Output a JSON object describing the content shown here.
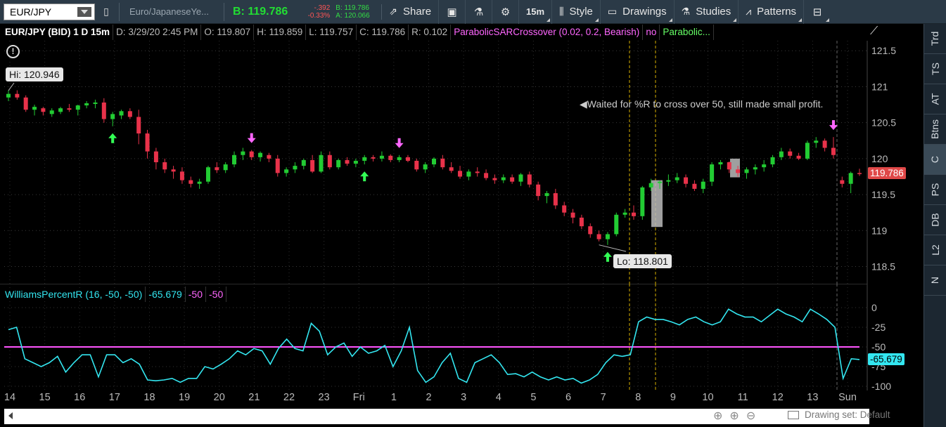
{
  "toolbar": {
    "symbol": "EUR/JPY",
    "description": "Euro/JapaneseYe...",
    "last": "B: 119.786",
    "change_net": "-.392",
    "change_pct": "-0.33%",
    "bid": "B: 119.786",
    "ask": "A: 120.066",
    "share_label": "Share",
    "timeframe_label": "15m",
    "style_label": "Style",
    "drawings_label": "Drawings",
    "studies_label": "Studies",
    "patterns_label": "Patterns"
  },
  "header": {
    "title": "EUR/JPY (BID) 1 D 15m",
    "date": "D: 3/29/20 2:45 PM",
    "open": "O: 119.807",
    "high": "H: 119.859",
    "low": "L: 119.757",
    "close": "C: 119.786",
    "range": "R: 0.102",
    "strategy": "ParabolicSARCrossover (0.02, 0.2, Bearish)",
    "strategy_flag": "no",
    "strategy2": "Parabolic..."
  },
  "price_panel": {
    "hi_label": "Hi: 120.946",
    "lo_label": "Lo: 118.801",
    "note": "Waited for %R to cross over 50, still made small profit.",
    "current_price": "119.786",
    "y_ticks": [
      "121.5",
      "121",
      "120.5",
      "120",
      "119.5",
      "119",
      "118.5"
    ]
  },
  "indicator": {
    "name": "WilliamsPercentR (16, -50, -50)",
    "value": "-65.679",
    "level1": "-50",
    "level2": "-50",
    "y_ticks": [
      "0",
      "-25",
      "-50",
      "-75",
      "-100"
    ],
    "current_value": "-65.679"
  },
  "x_labels": [
    "14",
    "15",
    "16",
    "17",
    "18",
    "19",
    "20",
    "21",
    "22",
    "23",
    "Fri",
    "1",
    "2",
    "3",
    "4",
    "5",
    "6",
    "7",
    "8",
    "9",
    "10",
    "11",
    "12",
    "13",
    "Sun"
  ],
  "sidebar_tabs": [
    "Trd",
    "TS",
    "AT",
    "Btns",
    "C",
    "PS",
    "DB",
    "L2",
    "N"
  ],
  "bottom": {
    "drawing_set": "Drawing set: Default"
  },
  "colors": {
    "up": "#22cc33",
    "down": "#e8324a",
    "pink": "#ff66ff",
    "cyan": "#33e6f0",
    "toolbar": "#2b3a47"
  },
  "chart_data": {
    "type": "candlestick",
    "x_labels": [
      "14",
      "15",
      "16",
      "17",
      "18",
      "19",
      "20",
      "21",
      "22",
      "23",
      "Fri",
      "1",
      "2",
      "3",
      "4",
      "5",
      "6",
      "7",
      "8",
      "9",
      "10",
      "11",
      "12",
      "13",
      "Sun"
    ],
    "price_ylim": [
      118.3,
      121.6
    ],
    "ohlc": [
      [
        120.85,
        120.95,
        120.8,
        120.9
      ],
      [
        120.9,
        120.95,
        120.82,
        120.85
      ],
      [
        120.85,
        120.88,
        120.65,
        120.68
      ],
      [
        120.68,
        120.75,
        120.6,
        120.72
      ],
      [
        120.7,
        120.72,
        120.6,
        120.65
      ],
      [
        120.62,
        120.7,
        120.58,
        120.67
      ],
      [
        120.65,
        120.72,
        120.62,
        120.7
      ],
      [
        120.7,
        120.76,
        120.65,
        120.68
      ],
      [
        120.68,
        120.75,
        120.6,
        120.74
      ],
      [
        120.74,
        120.8,
        120.7,
        120.77
      ],
      [
        120.76,
        120.82,
        120.7,
        120.78
      ],
      [
        120.78,
        120.84,
        120.5,
        120.55
      ],
      [
        120.55,
        120.65,
        120.45,
        120.62
      ],
      [
        120.6,
        120.68,
        120.55,
        120.66
      ],
      [
        120.66,
        120.7,
        120.55,
        120.58
      ],
      [
        120.58,
        120.68,
        120.2,
        120.35
      ],
      [
        120.35,
        120.4,
        120.0,
        120.1
      ],
      [
        120.1,
        120.15,
        119.85,
        119.95
      ],
      [
        119.95,
        120.0,
        119.8,
        119.85
      ],
      [
        119.85,
        119.9,
        119.72,
        119.82
      ],
      [
        119.82,
        119.88,
        119.65,
        119.7
      ],
      [
        119.7,
        119.75,
        119.6,
        119.65
      ],
      [
        119.65,
        119.72,
        119.58,
        119.68
      ],
      [
        119.68,
        119.9,
        119.65,
        119.88
      ],
      [
        119.88,
        119.95,
        119.8,
        119.84
      ],
      [
        119.84,
        119.95,
        119.8,
        119.92
      ],
      [
        119.92,
        120.1,
        119.88,
        120.05
      ],
      [
        120.05,
        120.15,
        119.98,
        120.1
      ],
      [
        120.1,
        120.12,
        119.98,
        120.02
      ],
      [
        120.02,
        120.1,
        119.96,
        120.08
      ],
      [
        120.05,
        120.08,
        119.95,
        120.0
      ],
      [
        120.0,
        120.05,
        119.75,
        119.8
      ],
      [
        119.8,
        119.88,
        119.75,
        119.85
      ],
      [
        119.85,
        119.95,
        119.8,
        119.9
      ],
      [
        119.9,
        120.0,
        119.85,
        119.98
      ],
      [
        119.98,
        120.05,
        119.8,
        119.82
      ],
      [
        119.82,
        120.1,
        119.8,
        120.05
      ],
      [
        120.05,
        120.1,
        119.85,
        119.88
      ],
      [
        119.88,
        120.0,
        119.85,
        119.98
      ],
      [
        119.98,
        120.02,
        119.9,
        119.93
      ],
      [
        119.93,
        120.0,
        119.88,
        119.97
      ],
      [
        119.97,
        120.05,
        119.92,
        120.02
      ],
      [
        120.02,
        120.05,
        119.96,
        120.0
      ],
      [
        120.0,
        120.1,
        119.96,
        120.04
      ],
      [
        120.04,
        120.06,
        119.95,
        119.98
      ],
      [
        119.98,
        120.05,
        119.95,
        120.02
      ],
      [
        120.02,
        120.05,
        119.95,
        119.97
      ],
      [
        119.97,
        120.0,
        119.82,
        119.85
      ],
      [
        119.85,
        119.95,
        119.8,
        119.92
      ],
      [
        119.92,
        120.02,
        119.88,
        120.0
      ],
      [
        120.0,
        120.05,
        119.85,
        119.88
      ],
      [
        119.88,
        119.95,
        119.8,
        119.83
      ],
      [
        119.83,
        119.9,
        119.72,
        119.75
      ],
      [
        119.75,
        119.85,
        119.7,
        119.82
      ],
      [
        119.82,
        119.88,
        119.75,
        119.8
      ],
      [
        119.8,
        119.85,
        119.7,
        119.73
      ],
      [
        119.73,
        119.78,
        119.65,
        119.7
      ],
      [
        119.7,
        119.78,
        119.66,
        119.74
      ],
      [
        119.74,
        119.78,
        119.65,
        119.68
      ],
      [
        119.68,
        119.8,
        119.62,
        119.78
      ],
      [
        119.78,
        119.82,
        119.6,
        119.64
      ],
      [
        119.64,
        119.68,
        119.42,
        119.48
      ],
      [
        119.48,
        119.55,
        119.38,
        119.52
      ],
      [
        119.52,
        119.58,
        119.3,
        119.35
      ],
      [
        119.35,
        119.4,
        119.2,
        119.25
      ],
      [
        119.25,
        119.3,
        119.1,
        119.18
      ],
      [
        119.18,
        119.22,
        119.02,
        119.06
      ],
      [
        119.06,
        119.1,
        118.9,
        118.95
      ],
      [
        118.95,
        119.0,
        118.85,
        118.88
      ],
      [
        118.88,
        118.98,
        118.8,
        118.95
      ],
      [
        118.95,
        119.25,
        118.92,
        119.22
      ],
      [
        119.22,
        119.3,
        119.18,
        119.25
      ],
      [
        119.25,
        119.35,
        119.15,
        119.2
      ],
      [
        119.2,
        119.62,
        119.15,
        119.6
      ],
      [
        119.6,
        119.72,
        119.55,
        119.66
      ],
      [
        119.66,
        119.7,
        119.58,
        119.68
      ],
      [
        119.68,
        119.78,
        119.62,
        119.7
      ],
      [
        119.7,
        119.8,
        119.66,
        119.74
      ],
      [
        119.74,
        119.78,
        119.6,
        119.65
      ],
      [
        119.65,
        119.7,
        119.55,
        119.58
      ],
      [
        119.58,
        119.72,
        119.52,
        119.68
      ],
      [
        119.68,
        119.95,
        119.62,
        119.92
      ],
      [
        119.92,
        119.98,
        119.85,
        119.95
      ],
      [
        119.95,
        119.96,
        119.8,
        119.85
      ],
      [
        119.85,
        119.9,
        119.75,
        119.8
      ],
      [
        119.8,
        119.88,
        119.72,
        119.85
      ],
      [
        119.85,
        119.92,
        119.78,
        119.88
      ],
      [
        119.88,
        119.98,
        119.82,
        119.92
      ],
      [
        119.92,
        120.05,
        119.88,
        120.02
      ],
      [
        120.02,
        120.15,
        119.98,
        120.1
      ],
      [
        120.1,
        120.14,
        120.0,
        120.04
      ],
      [
        120.04,
        120.08,
        119.98,
        120.0
      ],
      [
        120.0,
        120.25,
        119.98,
        120.22
      ],
      [
        120.22,
        120.3,
        120.15,
        120.25
      ],
      [
        120.25,
        120.28,
        120.1,
        120.15
      ],
      [
        120.15,
        120.3,
        120.0,
        120.05
      ],
      [
        119.7,
        119.75,
        119.6,
        119.65
      ],
      [
        119.65,
        119.82,
        119.52,
        119.8
      ],
      [
        119.8,
        119.86,
        119.76,
        119.786
      ]
    ],
    "buy_signals": [
      12,
      41,
      69
    ],
    "sell_signals": [
      28,
      45,
      95
    ],
    "williams_r": {
      "values": [
        -28,
        -25,
        -65,
        -70,
        -75,
        -70,
        -62,
        -82,
        -70,
        -60,
        -60,
        -88,
        -60,
        -60,
        -70,
        -65,
        -72,
        -92,
        -93,
        -92,
        -90,
        -95,
        -90,
        -90,
        -75,
        -78,
        -72,
        -65,
        -55,
        -60,
        -52,
        -55,
        -72,
        -52,
        -40,
        -52,
        -55,
        -20,
        -30,
        -60,
        -50,
        -45,
        -62,
        -50,
        -58,
        -55,
        -48,
        -75,
        -55,
        -25,
        -80,
        -95,
        -88,
        -70,
        -58,
        -90,
        -95,
        -70,
        -65,
        -60,
        -70,
        -85,
        -84,
        -88,
        -82,
        -88,
        -92,
        -88,
        -92,
        -90,
        -96,
        -92,
        -85,
        -70,
        -60,
        -62,
        -60,
        -18,
        -12,
        -15,
        -15,
        -18,
        -22,
        -15,
        -12,
        -18,
        -22,
        -18,
        -2,
        -8,
        -12,
        -12,
        -18,
        -10,
        -2,
        -8,
        -12,
        -18,
        -2,
        -8,
        -15,
        -25,
        -90,
        -65,
        -66
      ],
      "ylim": [
        -100,
        0
      ],
      "levels": [
        -50,
        -50
      ]
    }
  }
}
